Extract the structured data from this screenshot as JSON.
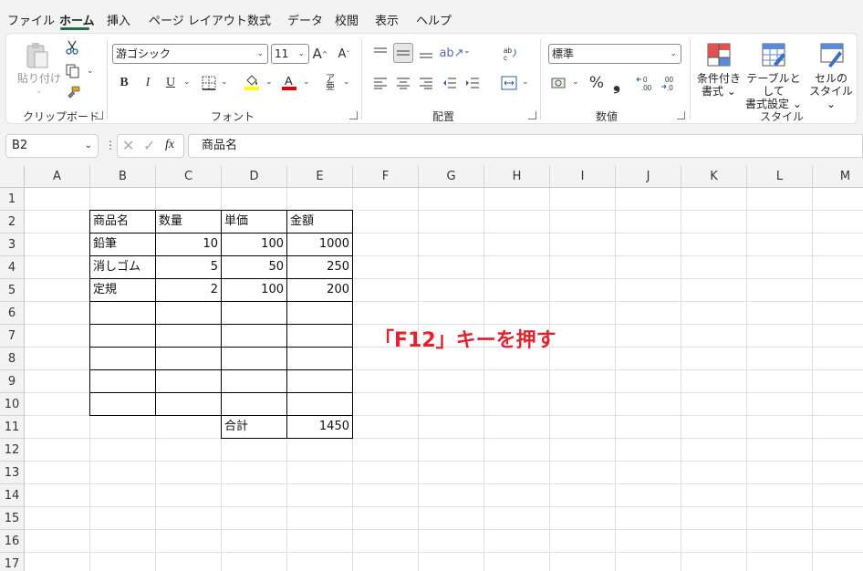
{
  "menu": {
    "tabs": [
      "ファイル",
      "ホーム",
      "挿入",
      "ページ レイアウト",
      "数式",
      "データ",
      "校閲",
      "表示",
      "ヘルプ"
    ],
    "active_index": 1
  },
  "ribbon": {
    "clipboard": {
      "label": "クリップボード",
      "paste_label": "貼り付け"
    },
    "font": {
      "label": "フォント",
      "font_name": "游ゴシック",
      "font_size": "11",
      "bold": "B",
      "italic": "I",
      "underline": "U",
      "grow": "A",
      "shrink": "A"
    },
    "alignment": {
      "label": "配置"
    },
    "number": {
      "label": "数値",
      "format": "標準",
      "percent": "%",
      "comma": "❟"
    },
    "styles": {
      "label": "スタイル",
      "conditional_line1": "条件付き",
      "conditional_line2": "書式",
      "table_line1": "テーブルとして",
      "table_line2": "書式設定",
      "cell_line1": "セルの",
      "cell_line2": "スタイル"
    }
  },
  "formula_bar": {
    "name_box": "B2",
    "fx": "fx",
    "content": "商品名"
  },
  "sheet": {
    "columns": [
      "A",
      "B",
      "C",
      "D",
      "E",
      "F",
      "G",
      "H",
      "I",
      "J",
      "K",
      "L",
      "M"
    ],
    "rows": [
      "1",
      "2",
      "3",
      "4",
      "5",
      "6",
      "7",
      "8",
      "9",
      "10",
      "11",
      "12",
      "13",
      "14",
      "15",
      "16",
      "17"
    ],
    "headers": [
      "商品名",
      "数量",
      "単価",
      "金額"
    ],
    "items": [
      {
        "name": "鉛筆",
        "qty": "10",
        "price": "100",
        "amount": "1000"
      },
      {
        "name": "消しゴム",
        "qty": "5",
        "price": "50",
        "amount": "250"
      },
      {
        "name": "定規",
        "qty": "2",
        "price": "100",
        "amount": "200"
      }
    ],
    "total_label": "合計",
    "total_value": "1450"
  },
  "callout": "「F12」キーを押す",
  "colors": {
    "accent": "#1e7145",
    "callout": "#e0232e"
  }
}
